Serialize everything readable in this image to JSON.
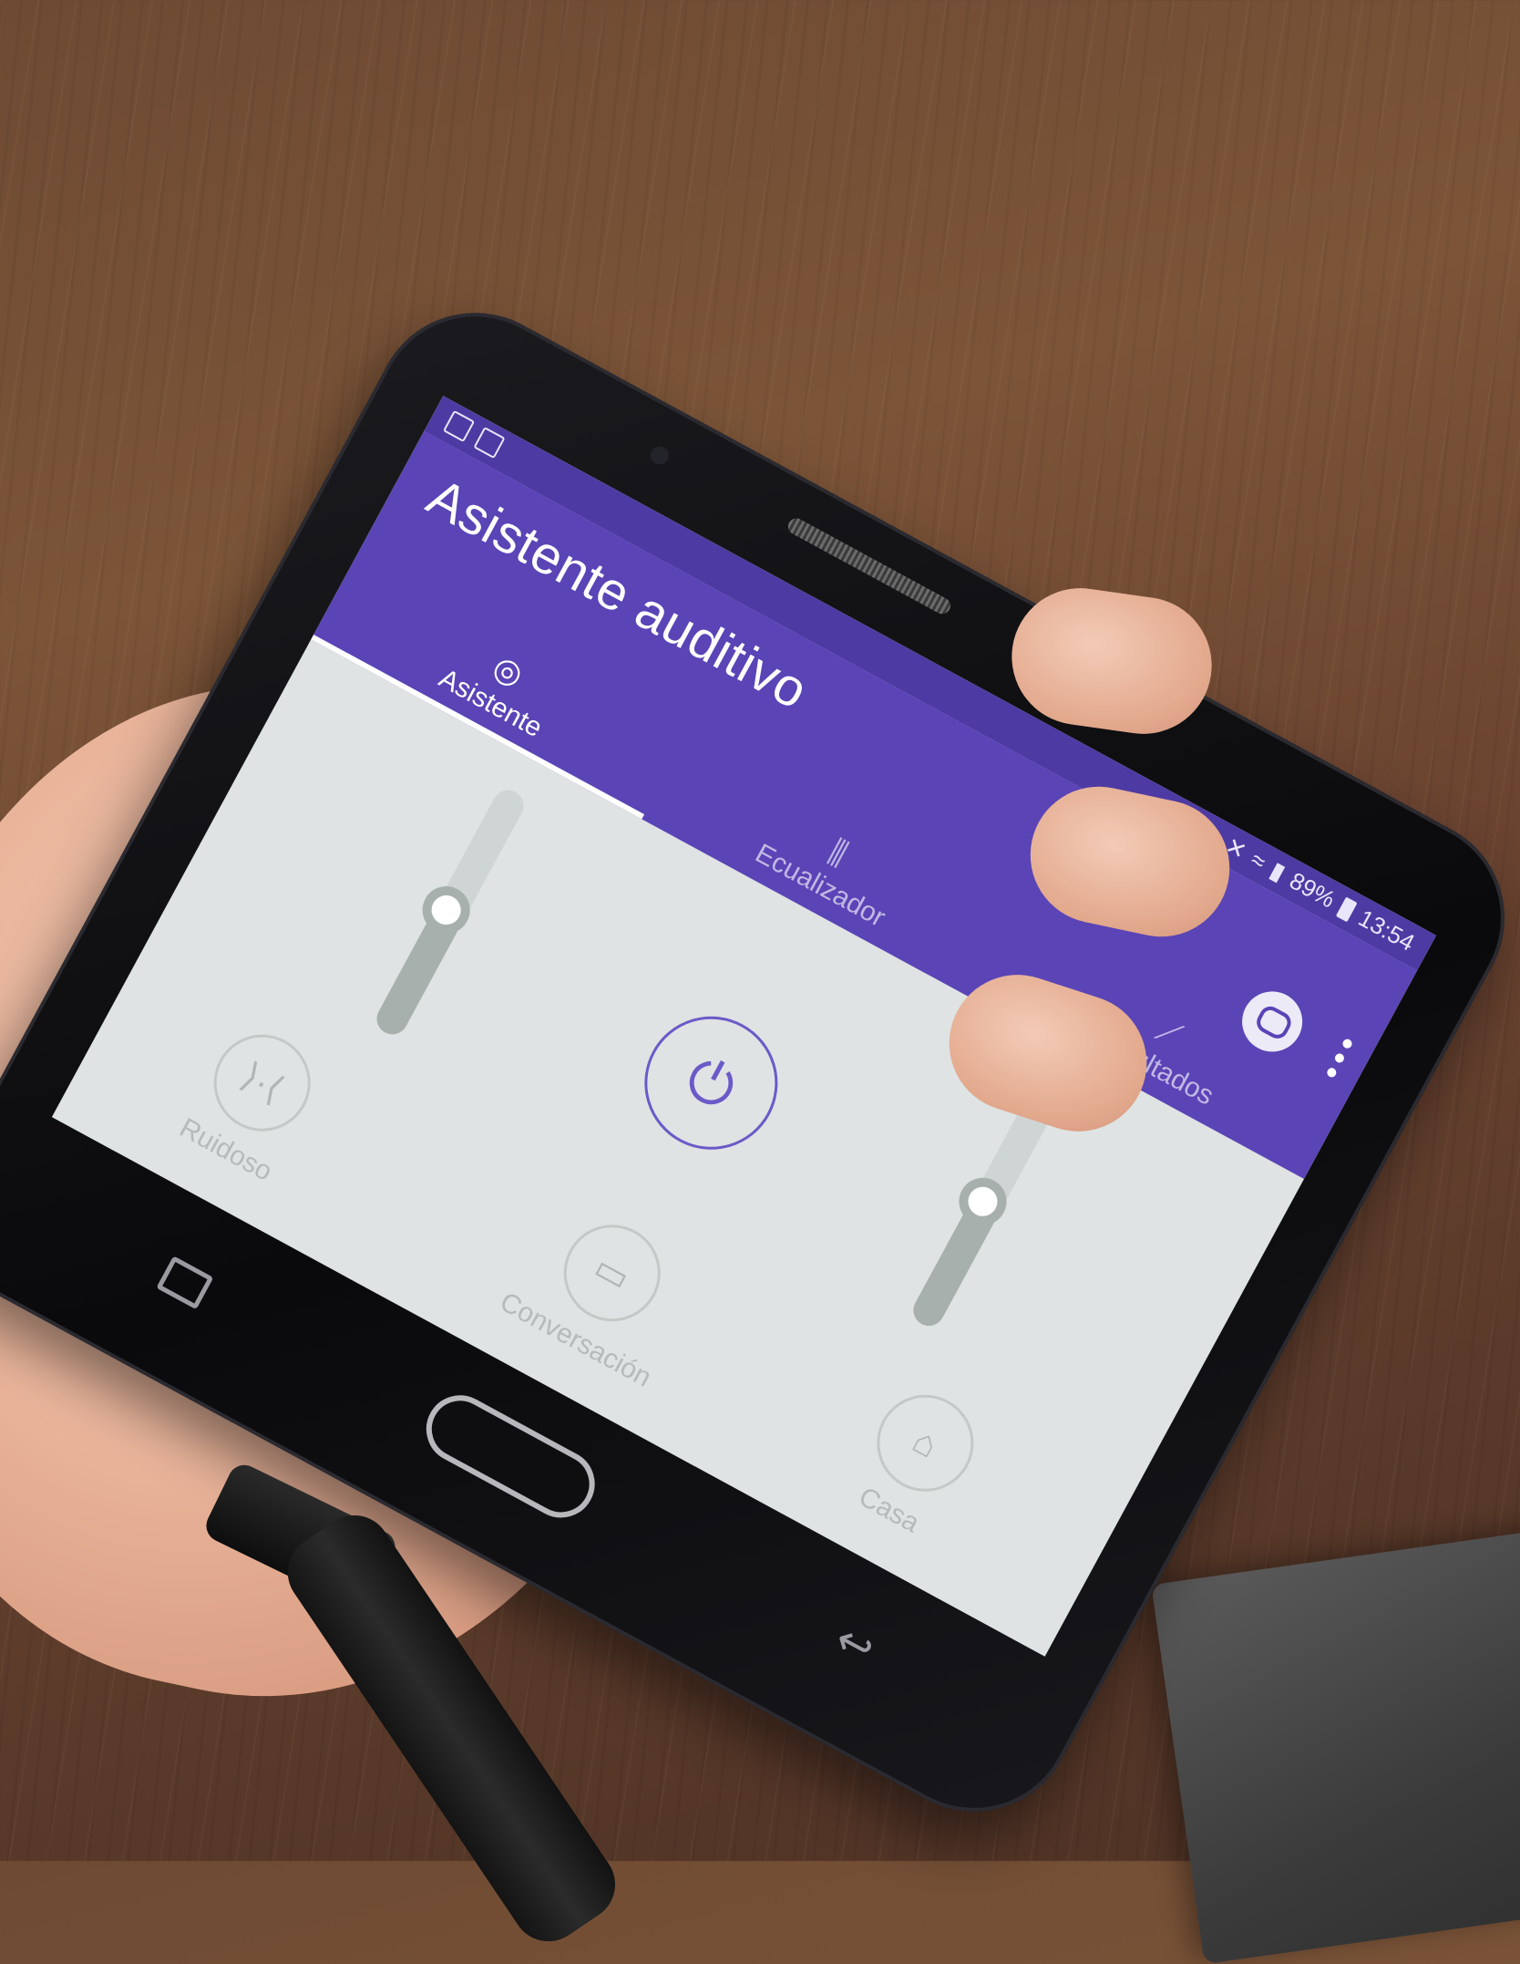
{
  "status_bar": {
    "battery_percent": "89%",
    "time": "13:54",
    "signal_icon": "signal-icon",
    "wifi_icon": "wifi-icon",
    "mute_icon": "mute-icon"
  },
  "app": {
    "title": "Asistente auditivo",
    "accent_color": "#5a44b6",
    "actions": {
      "chat_icon": "chat-icon",
      "menu_icon": "more-vert-icon"
    }
  },
  "tabs": [
    {
      "label": "Asistente",
      "icon": "target-icon",
      "active": true
    },
    {
      "label": "Ecualizador",
      "icon": "equalizer-icon",
      "active": false
    },
    {
      "label": "Resultados",
      "icon": "trend-icon",
      "active": false
    }
  ],
  "controls": {
    "left_slider_level": 0.5,
    "right_slider_level": 0.5,
    "power_icon": "power-icon"
  },
  "modes": [
    {
      "label": "Ruidoso",
      "icon": "noise-icon"
    },
    {
      "label": "Conversación",
      "icon": "conversation-icon"
    },
    {
      "label": "Casa",
      "icon": "home-icon"
    }
  ]
}
